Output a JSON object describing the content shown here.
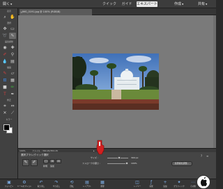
{
  "topbar": {
    "open_label": "開く",
    "modes": {
      "quick": "クイック",
      "guided": "ガイド",
      "expert": "エキスパート"
    },
    "create_label": "作成",
    "share_label": "共有"
  },
  "toolbox": {
    "sections": {
      "view": "表示",
      "select": "選択",
      "enhance": "画質調整",
      "draw": "描画",
      "modify": "修正",
      "color": "カラー"
    }
  },
  "document": {
    "tab_title": "IMG_0191.jpg @ 100% (RGB/8)"
  },
  "status": {
    "zoom": "100%",
    "info": "ファイル : 364.2K/364.2K"
  },
  "options": {
    "title": "選択ブラシ/クイック選択",
    "new_selection": "新規",
    "add_to": "追加",
    "subtract": "削除",
    "size_label": "サイズ :",
    "size_value": "300 px",
    "size_level": 0.55,
    "hardness_label": "ストロークの硬さ :",
    "hardness_value": "100%",
    "hardness_level": 1.0,
    "refine_button": "境界線を調整...",
    "sample_all": "全レイヤーを対象",
    "auto_enhance": "自動調整"
  },
  "taskbar": {
    "items": [
      {
        "icon": "photo-bin-icon",
        "label": "フォトビン"
      },
      {
        "icon": "tool-options-icon",
        "label": "ツールオプション"
      },
      {
        "icon": "undo-icon",
        "label": "取り消し"
      },
      {
        "icon": "redo-icon",
        "label": "やり直し"
      },
      {
        "icon": "rotate-icon",
        "label": "回転"
      },
      {
        "icon": "layout-icon",
        "label": "レイアウト"
      },
      {
        "icon": "organizer-icon",
        "label": "整理"
      },
      {
        "icon": "layers-icon",
        "label": "レイヤー"
      },
      {
        "icon": "effects-icon",
        "label": "効果"
      },
      {
        "icon": "add-icon",
        "label": "追加"
      },
      {
        "icon": "graphics-icon",
        "label": "グラフィック"
      },
      {
        "icon": "more-icon",
        "label": "その他"
      }
    ]
  },
  "colors": {
    "accent": "#7fb0e8",
    "canvas_bg": "#7a7a7a",
    "panel_bg": "#414141",
    "cursor_red": "#d02020"
  }
}
